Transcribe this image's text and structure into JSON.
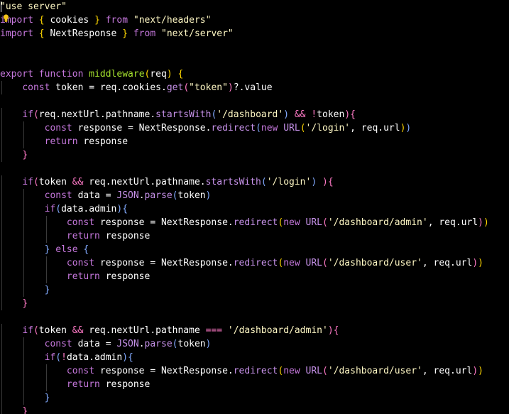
{
  "editor": {
    "lines": [
      [
        {
          "t": "\"use server\"",
          "c": "string"
        }
      ],
      [
        {
          "t": "import",
          "c": "keyword"
        },
        {
          "t": " ",
          "c": "plain"
        },
        {
          "t": "{",
          "c": "paren3"
        },
        {
          "t": " cookies ",
          "c": "plain"
        },
        {
          "t": "}",
          "c": "paren3"
        },
        {
          "t": " ",
          "c": "plain"
        },
        {
          "t": "from",
          "c": "keyword"
        },
        {
          "t": " ",
          "c": "plain"
        },
        {
          "t": "\"next/headers\"",
          "c": "string"
        }
      ],
      [
        {
          "t": "import",
          "c": "keyword"
        },
        {
          "t": " ",
          "c": "plain"
        },
        {
          "t": "{",
          "c": "paren3"
        },
        {
          "t": " NextResponse ",
          "c": "plain"
        },
        {
          "t": "}",
          "c": "paren3"
        },
        {
          "t": " ",
          "c": "plain"
        },
        {
          "t": "from",
          "c": "keyword"
        },
        {
          "t": " ",
          "c": "plain"
        },
        {
          "t": "\"next/server\"",
          "c": "string"
        }
      ],
      [],
      [],
      [
        {
          "t": "export",
          "c": "keyword"
        },
        {
          "t": " ",
          "c": "plain"
        },
        {
          "t": "function",
          "c": "keyword"
        },
        {
          "t": " ",
          "c": "plain"
        },
        {
          "t": "middleware",
          "c": "func"
        },
        {
          "t": "(",
          "c": "paren3"
        },
        {
          "t": "req",
          "c": "plain"
        },
        {
          "t": ")",
          "c": "paren3"
        },
        {
          "t": " ",
          "c": "plain"
        },
        {
          "t": "{",
          "c": "paren3"
        }
      ],
      [
        {
          "t": "    ",
          "c": "plain"
        },
        {
          "t": "const",
          "c": "keyword"
        },
        {
          "t": " token = req.cookies.",
          "c": "plain"
        },
        {
          "t": "get",
          "c": "method"
        },
        {
          "t": "(",
          "c": "paren"
        },
        {
          "t": "\"token\"",
          "c": "string"
        },
        {
          "t": ")",
          "c": "paren"
        },
        {
          "t": "?.value",
          "c": "plain"
        }
      ],
      [],
      [
        {
          "t": "    ",
          "c": "plain"
        },
        {
          "t": "if",
          "c": "keyword"
        },
        {
          "t": "(",
          "c": "paren"
        },
        {
          "t": "req.nextUrl.pathname.",
          "c": "plain"
        },
        {
          "t": "startsWith",
          "c": "method"
        },
        {
          "t": "(",
          "c": "paren2"
        },
        {
          "t": "'/dashboard'",
          "c": "string"
        },
        {
          "t": ")",
          "c": "paren2"
        },
        {
          "t": " ",
          "c": "plain"
        },
        {
          "t": "&&",
          "c": "op"
        },
        {
          "t": " ",
          "c": "plain"
        },
        {
          "t": "!",
          "c": "op"
        },
        {
          "t": "token",
          "c": "plain"
        },
        {
          "t": ")",
          "c": "paren"
        },
        {
          "t": "{",
          "c": "paren"
        }
      ],
      [
        {
          "t": "        ",
          "c": "plain"
        },
        {
          "t": "const",
          "c": "keyword"
        },
        {
          "t": " response = NextResponse.",
          "c": "plain"
        },
        {
          "t": "redirect",
          "c": "method"
        },
        {
          "t": "(",
          "c": "paren2"
        },
        {
          "t": "new",
          "c": "keyword"
        },
        {
          "t": " ",
          "c": "plain"
        },
        {
          "t": "URL",
          "c": "builtin"
        },
        {
          "t": "(",
          "c": "paren3"
        },
        {
          "t": "'/login'",
          "c": "string"
        },
        {
          "t": ", req.url",
          "c": "plain"
        },
        {
          "t": ")",
          "c": "paren3"
        },
        {
          "t": ")",
          "c": "paren2"
        }
      ],
      [
        {
          "t": "        ",
          "c": "plain"
        },
        {
          "t": "return",
          "c": "keyword"
        },
        {
          "t": " response",
          "c": "plain"
        }
      ],
      [
        {
          "t": "    ",
          "c": "plain"
        },
        {
          "t": "}",
          "c": "paren"
        }
      ],
      [],
      [
        {
          "t": "    ",
          "c": "plain"
        },
        {
          "t": "if",
          "c": "keyword"
        },
        {
          "t": "(",
          "c": "paren"
        },
        {
          "t": "token ",
          "c": "plain"
        },
        {
          "t": "&&",
          "c": "op"
        },
        {
          "t": " req.nextUrl.pathname.",
          "c": "plain"
        },
        {
          "t": "startsWith",
          "c": "method"
        },
        {
          "t": "(",
          "c": "paren2"
        },
        {
          "t": "'/login'",
          "c": "string"
        },
        {
          "t": ")",
          "c": "paren2"
        },
        {
          "t": " ",
          "c": "plain"
        },
        {
          "t": ")",
          "c": "paren"
        },
        {
          "t": "{",
          "c": "paren"
        }
      ],
      [
        {
          "t": "        ",
          "c": "plain"
        },
        {
          "t": "const",
          "c": "keyword"
        },
        {
          "t": " data = ",
          "c": "plain"
        },
        {
          "t": "JSON",
          "c": "builtin"
        },
        {
          "t": ".",
          "c": "plain"
        },
        {
          "t": "parse",
          "c": "method"
        },
        {
          "t": "(",
          "c": "paren2"
        },
        {
          "t": "token",
          "c": "plain"
        },
        {
          "t": ")",
          "c": "paren2"
        }
      ],
      [
        {
          "t": "        ",
          "c": "plain"
        },
        {
          "t": "if",
          "c": "keyword"
        },
        {
          "t": "(",
          "c": "paren2"
        },
        {
          "t": "data.admin",
          "c": "plain"
        },
        {
          "t": ")",
          "c": "paren2"
        },
        {
          "t": "{",
          "c": "paren2"
        }
      ],
      [
        {
          "t": "            ",
          "c": "plain"
        },
        {
          "t": "const",
          "c": "keyword"
        },
        {
          "t": " response = NextResponse.",
          "c": "plain"
        },
        {
          "t": "redirect",
          "c": "method"
        },
        {
          "t": "(",
          "c": "paren3"
        },
        {
          "t": "new",
          "c": "keyword"
        },
        {
          "t": " ",
          "c": "plain"
        },
        {
          "t": "URL",
          "c": "builtin"
        },
        {
          "t": "(",
          "c": "paren"
        },
        {
          "t": "'/dashboard/admin'",
          "c": "string"
        },
        {
          "t": ", req.url",
          "c": "plain"
        },
        {
          "t": ")",
          "c": "paren"
        },
        {
          "t": ")",
          "c": "paren3"
        }
      ],
      [
        {
          "t": "            ",
          "c": "plain"
        },
        {
          "t": "return",
          "c": "keyword"
        },
        {
          "t": " response",
          "c": "plain"
        }
      ],
      [
        {
          "t": "        ",
          "c": "plain"
        },
        {
          "t": "}",
          "c": "paren2"
        },
        {
          "t": " ",
          "c": "plain"
        },
        {
          "t": "else",
          "c": "keyword"
        },
        {
          "t": " ",
          "c": "plain"
        },
        {
          "t": "{",
          "c": "paren2"
        }
      ],
      [
        {
          "t": "            ",
          "c": "plain"
        },
        {
          "t": "const",
          "c": "keyword"
        },
        {
          "t": " response = NextResponse.",
          "c": "plain"
        },
        {
          "t": "redirect",
          "c": "method"
        },
        {
          "t": "(",
          "c": "paren3"
        },
        {
          "t": "new",
          "c": "keyword"
        },
        {
          "t": " ",
          "c": "plain"
        },
        {
          "t": "URL",
          "c": "builtin"
        },
        {
          "t": "(",
          "c": "paren"
        },
        {
          "t": "'/dashboard/user'",
          "c": "string"
        },
        {
          "t": ", req.url",
          "c": "plain"
        },
        {
          "t": ")",
          "c": "paren"
        },
        {
          "t": ")",
          "c": "paren3"
        }
      ],
      [
        {
          "t": "            ",
          "c": "plain"
        },
        {
          "t": "return",
          "c": "keyword"
        },
        {
          "t": " response",
          "c": "plain"
        }
      ],
      [
        {
          "t": "        ",
          "c": "plain"
        },
        {
          "t": "}",
          "c": "paren2"
        }
      ],
      [
        {
          "t": "    ",
          "c": "plain"
        },
        {
          "t": "}",
          "c": "paren"
        }
      ],
      [],
      [
        {
          "t": "    ",
          "c": "plain"
        },
        {
          "t": "if",
          "c": "keyword"
        },
        {
          "t": "(",
          "c": "paren"
        },
        {
          "t": "token ",
          "c": "plain"
        },
        {
          "t": "&&",
          "c": "op"
        },
        {
          "t": " req.nextUrl.pathname ",
          "c": "plain"
        },
        {
          "t": "===",
          "c": "op"
        },
        {
          "t": " ",
          "c": "plain"
        },
        {
          "t": "'/dashboard/admin'",
          "c": "string"
        },
        {
          "t": ")",
          "c": "paren"
        },
        {
          "t": "{",
          "c": "paren"
        }
      ],
      [
        {
          "t": "        ",
          "c": "plain"
        },
        {
          "t": "const",
          "c": "keyword"
        },
        {
          "t": " data = ",
          "c": "plain"
        },
        {
          "t": "JSON",
          "c": "builtin"
        },
        {
          "t": ".",
          "c": "plain"
        },
        {
          "t": "parse",
          "c": "method"
        },
        {
          "t": "(",
          "c": "paren2"
        },
        {
          "t": "token",
          "c": "plain"
        },
        {
          "t": ")",
          "c": "paren2"
        }
      ],
      [
        {
          "t": "        ",
          "c": "plain"
        },
        {
          "t": "if",
          "c": "keyword"
        },
        {
          "t": "(",
          "c": "paren2"
        },
        {
          "t": "!",
          "c": "op"
        },
        {
          "t": "data.admin",
          "c": "plain"
        },
        {
          "t": ")",
          "c": "paren2"
        },
        {
          "t": "{",
          "c": "paren2"
        }
      ],
      [
        {
          "t": "            ",
          "c": "plain"
        },
        {
          "t": "const",
          "c": "keyword"
        },
        {
          "t": " response = NextResponse.",
          "c": "plain"
        },
        {
          "t": "redirect",
          "c": "method"
        },
        {
          "t": "(",
          "c": "paren3"
        },
        {
          "t": "new",
          "c": "keyword"
        },
        {
          "t": " ",
          "c": "plain"
        },
        {
          "t": "URL",
          "c": "builtin"
        },
        {
          "t": "(",
          "c": "paren"
        },
        {
          "t": "'/dashboard/user'",
          "c": "string"
        },
        {
          "t": ", req.url",
          "c": "plain"
        },
        {
          "t": ")",
          "c": "paren"
        },
        {
          "t": ")",
          "c": "paren3"
        }
      ],
      [
        {
          "t": "            ",
          "c": "plain"
        },
        {
          "t": "return",
          "c": "keyword"
        },
        {
          "t": " response",
          "c": "plain"
        }
      ],
      [
        {
          "t": "        ",
          "c": "plain"
        },
        {
          "t": "}",
          "c": "paren2"
        }
      ],
      [
        {
          "t": "    ",
          "c": "plain"
        },
        {
          "t": "}",
          "c": "paren"
        }
      ]
    ],
    "colors": {
      "background": "#000000",
      "keyword": "#c678dd",
      "function": "#a6e22e",
      "string": "#fff8c4",
      "bracket_pink": "#ff79c6",
      "bracket_blue": "#82aaff",
      "bracket_gold": "#ffd700"
    },
    "icons": {
      "lightbulb": "lightbulb-icon",
      "cursor": "text-cursor"
    }
  }
}
